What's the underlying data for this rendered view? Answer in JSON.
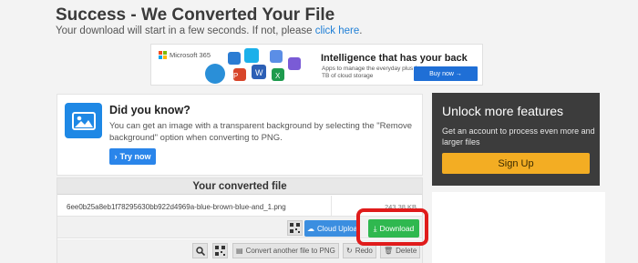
{
  "header": {
    "title": "Success - We Converted Your File",
    "subtitle_text": "Your download will start in a few seconds. If not, please ",
    "subtitle_link": "click here",
    "subtitle_end": "."
  },
  "ad": {
    "brand": "Microsoft 365",
    "headline": "Intelligence that has your back",
    "body": "Apps to manage the everyday plus 1 TB of cloud storage",
    "button": "Buy now →"
  },
  "tip": {
    "title": "Did you know?",
    "text": "You can get an image with a transparent background by selecting the \"Remove background\" option when converting to PNG.",
    "button": "Try now",
    "icon": "image-icon",
    "accent": "#1e88e5"
  },
  "file_panel": {
    "header": "Your converted file",
    "file_name": "6ee0b25a8eb1f78295630bb922d4969a-blue-brown-blue-and_1.png",
    "file_size": "243.38 KB",
    "cloud_upload": "Cloud Upload",
    "download": "Download",
    "convert_another": "Convert another file to PNG",
    "redo": "Redo",
    "delete": "Delete"
  },
  "unlock": {
    "title": "Unlock more features",
    "text": "Get an account to process even more and larger files",
    "button": "Sign Up"
  },
  "colors": {
    "download_green": "#2fb84f",
    "highlight_red": "#e01b1b",
    "signup_orange": "#f3ad23",
    "link_blue": "#1f7fd6"
  }
}
